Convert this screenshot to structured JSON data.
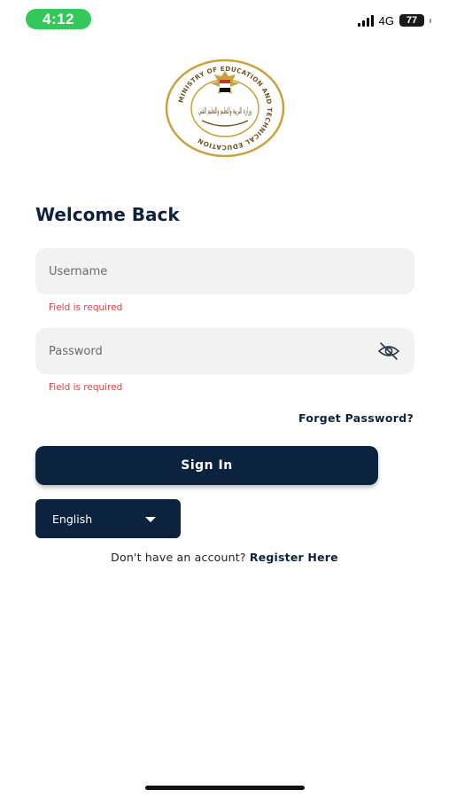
{
  "status_bar": {
    "time": "4:12",
    "network": "4G",
    "battery": "77"
  },
  "logo": {
    "text": "MINISTRY OF EDUCATION AND TECHNICAL EDUCATION",
    "arabic_text": "وزارة التربية والتعليم والتعليم الفني"
  },
  "login": {
    "title": "Welcome Back",
    "username_placeholder": "Username",
    "username_error": "Field is required",
    "password_placeholder": "Password",
    "password_error": "Field is required",
    "forget_password": "Forget Password?",
    "sign_in": "Sign In"
  },
  "language": {
    "selected": "English"
  },
  "register": {
    "prompt": "Don't have an account?",
    "link": "Register Here"
  },
  "colors": {
    "primary": "#0c2340",
    "error": "#d64545",
    "field_bg": "#f2f2f2",
    "time_pill": "#34c759"
  }
}
